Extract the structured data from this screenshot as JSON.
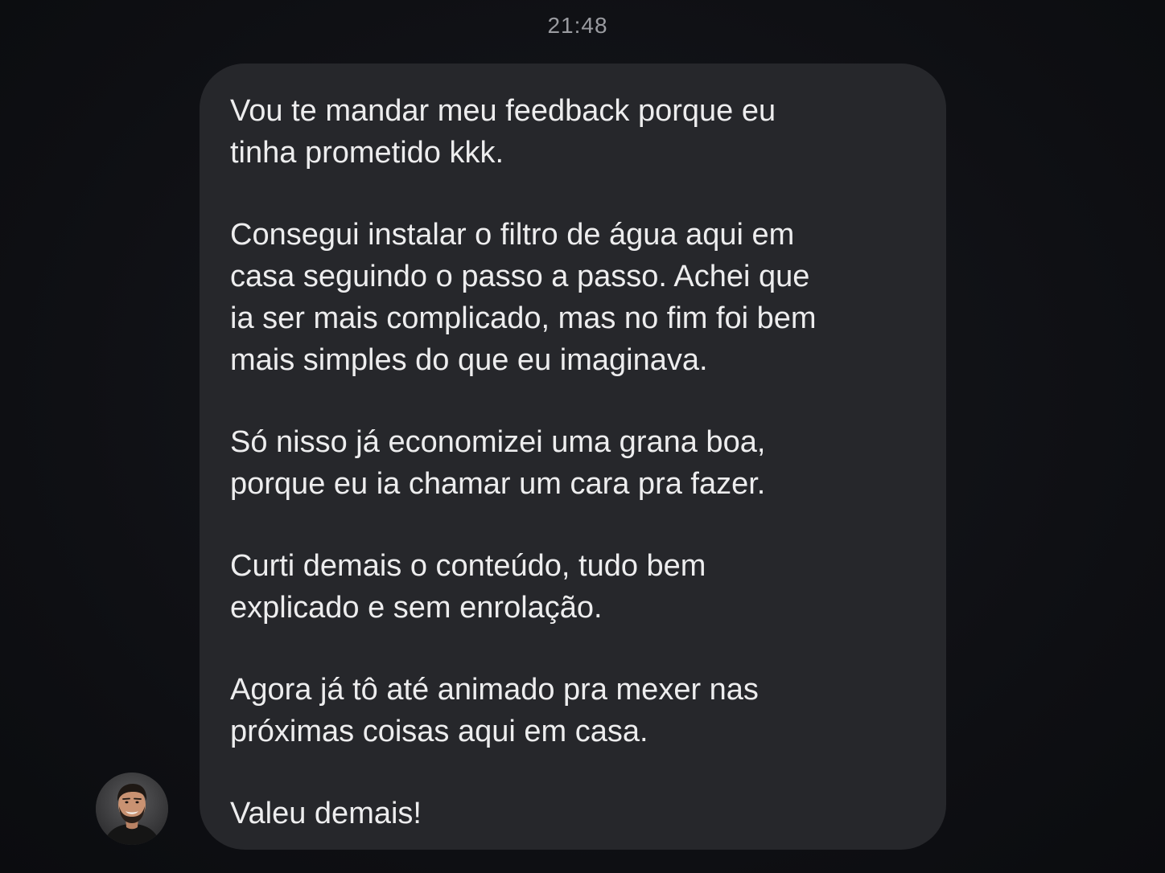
{
  "chat": {
    "timestamp": "21:48",
    "message": {
      "paragraphs": [
        "Vou te mandar meu feedback porque eu\ntinha prometido kkk.",
        "Consegui instalar o filtro de água aqui em\ncasa seguindo o passo a passo. Achei que\nia ser mais complicado, mas no fim foi bem\nmais simples do que eu imaginava.",
        "Só nisso já economizei uma grana boa,\nporque eu ia chamar um cara pra fazer.",
        "Curti demais o conteúdo, tudo bem\nexplicado e sem enrolação.",
        "Agora já tô até animado pra mexer nas\npróximas coisas aqui em casa.",
        "Valeu demais!"
      ]
    },
    "sender": {
      "avatar_icon": "user-avatar-photo"
    }
  },
  "colors": {
    "background": "#0d0e12",
    "bubble": "#26272b",
    "text": "#ededee",
    "timestamp": "#9a9ba0"
  }
}
